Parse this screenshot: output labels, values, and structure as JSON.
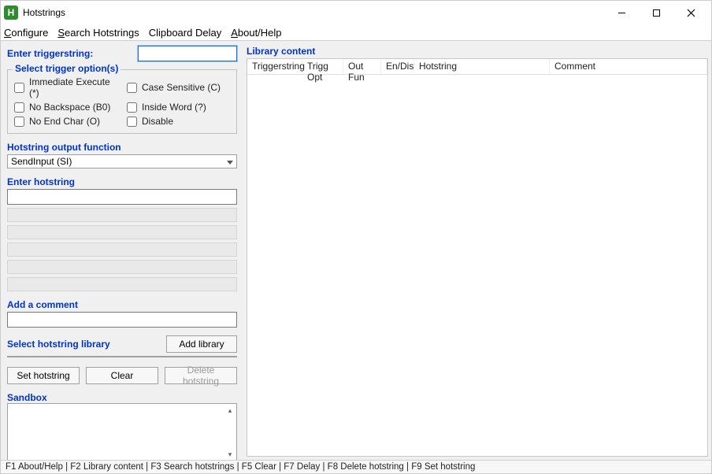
{
  "titlebar": {
    "icon_letter": "H",
    "title": "Hotstrings"
  },
  "menu": {
    "configure": "Configure",
    "search": "Search Hotstrings",
    "clipboard": "Clipboard Delay",
    "about": "About/Help"
  },
  "left": {
    "enter_trigger_label": "Enter triggerstring:",
    "triggerstring_value": "",
    "trigger_options_legend": "Select trigger option(s)",
    "opts": {
      "immediate": "Immediate Execute (*)",
      "case_sensitive": "Case Sensitive (C)",
      "no_backspace": "No Backspace (B0)",
      "inside_word": "Inside Word (?)",
      "no_end_char": "No End Char (O)",
      "disable": "Disable"
    },
    "output_fn_label": "Hotstring output function",
    "output_fn_value": "SendInput (SI)",
    "enter_hotstring_label": "Enter hotstring",
    "hotstring_value": "",
    "add_comment_label": "Add a comment",
    "comment_value": "",
    "select_library_label": "Select hotstring library",
    "add_library_btn": "Add library",
    "library_value": "",
    "set_btn": "Set hotstring",
    "clear_btn": "Clear",
    "delete_btn": "Delete hotstring",
    "sandbox_label": "Sandbox"
  },
  "right": {
    "library_content_label": "Library content",
    "cols": {
      "trigger": "Triggerstring",
      "opt": "Trigg Opt",
      "fun": "Out Fun",
      "ed": "En/Dis",
      "hot": "Hotstring",
      "com": "Comment"
    }
  },
  "status": {
    "text": "F1 About/Help | F2 Library content | F3 Search hotstrings | F5 Clear | F7 Delay | F8 Delete hotstring | F9 Set hotstring"
  }
}
